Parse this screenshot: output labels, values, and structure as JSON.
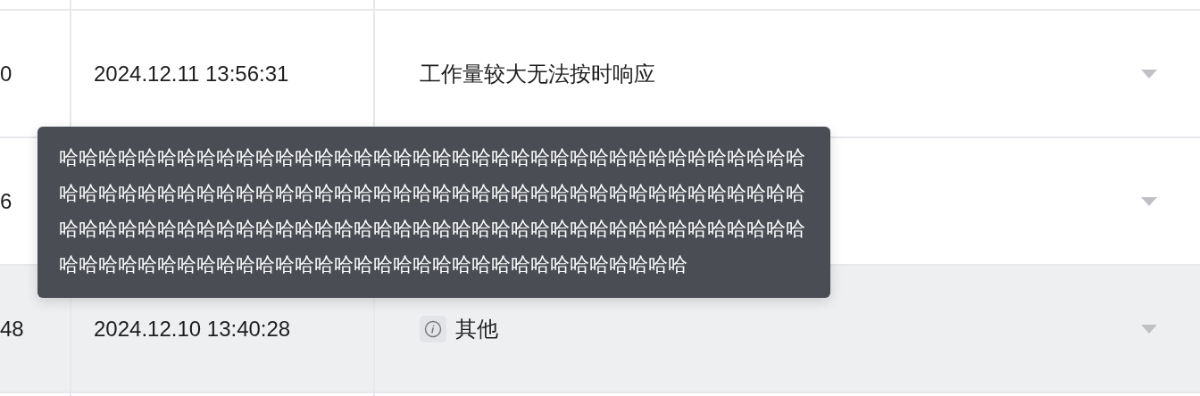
{
  "table": {
    "rows": [
      {
        "column_1": "0",
        "time": "2024.12.11 13:56:31",
        "reason": {
          "kind": "plain",
          "text": "工作量较大无法按时响应"
        },
        "hovered": false
      },
      {
        "column_1": "6",
        "hovered": false
      },
      {
        "column_1": "48",
        "time": "2024.12.10 13:40:28",
        "reason": {
          "kind": "info",
          "text": "其他"
        },
        "hovered": true
      }
    ]
  },
  "tooltip": {
    "text": "哈哈哈哈哈哈哈哈哈哈哈哈哈哈哈哈哈哈哈哈哈哈哈哈哈哈哈哈哈哈哈哈哈哈哈哈哈哈哈哈哈哈哈哈哈哈哈哈哈哈哈哈哈哈哈哈哈哈哈哈哈哈哈哈哈哈哈哈哈哈哈哈哈哈哈哈哈哈哈哈哈哈哈哈哈哈哈哈哈哈哈哈哈哈哈哈哈哈哈哈哈哈哈哈哈哈哈哈哈哈哈哈哈哈哈哈哈哈哈哈哈哈哈哈哈哈哈哈哈哈哈哈哈哈哈哈哈哈哈哈哈哈哈哈哈哈"
  }
}
